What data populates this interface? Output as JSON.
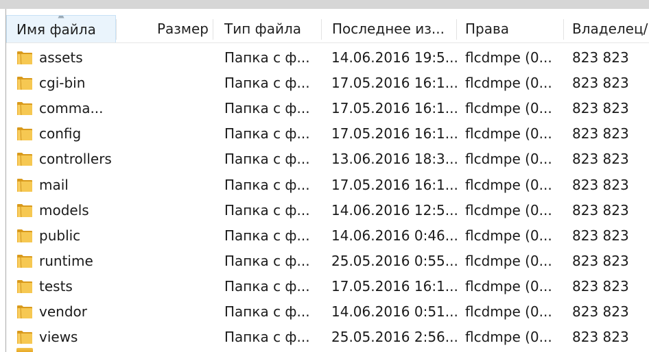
{
  "columns": [
    {
      "label": "Имя файла"
    },
    {
      "label": "Размер"
    },
    {
      "label": "Тип файла"
    },
    {
      "label": "Последнее из..."
    },
    {
      "label": "Права"
    },
    {
      "label": "Владелец/"
    }
  ],
  "sort_arrow": "▲",
  "rows": [
    {
      "name": "assets",
      "size": "",
      "type": "Папка с ф...",
      "modified": "14.06.2016 19:5...",
      "perms": "flcdmpe (0...",
      "owner": "823 823"
    },
    {
      "name": "cgi-bin",
      "size": "",
      "type": "Папка с ф...",
      "modified": "17.05.2016 16:1...",
      "perms": "flcdmpe (0...",
      "owner": "823 823"
    },
    {
      "name": "comma...",
      "size": "",
      "type": "Папка с ф...",
      "modified": "17.05.2016 16:1...",
      "perms": "flcdmpe (0...",
      "owner": "823 823"
    },
    {
      "name": "config",
      "size": "",
      "type": "Папка с ф...",
      "modified": "17.05.2016 16:1...",
      "perms": "flcdmpe (0...",
      "owner": "823 823"
    },
    {
      "name": "controllers",
      "size": "",
      "type": "Папка с ф...",
      "modified": "13.06.2016 18:3...",
      "perms": "flcdmpe (0...",
      "owner": "823 823"
    },
    {
      "name": "mail",
      "size": "",
      "type": "Папка с ф...",
      "modified": "17.05.2016 16:1...",
      "perms": "flcdmpe (0...",
      "owner": "823 823"
    },
    {
      "name": "models",
      "size": "",
      "type": "Папка с ф...",
      "modified": "14.06.2016 12:5...",
      "perms": "flcdmpe (0...",
      "owner": "823 823"
    },
    {
      "name": "public",
      "size": "",
      "type": "Папка с ф...",
      "modified": "14.06.2016 0:46...",
      "perms": "flcdmpe (0...",
      "owner": "823 823"
    },
    {
      "name": "runtime",
      "size": "",
      "type": "Папка с ф...",
      "modified": "25.05.2016 0:55...",
      "perms": "flcdmpe (0...",
      "owner": "823 823"
    },
    {
      "name": "tests",
      "size": "",
      "type": "Папка с ф...",
      "modified": "17.05.2016 16:1...",
      "perms": "flcdmpe (0...",
      "owner": "823 823"
    },
    {
      "name": "vendor",
      "size": "",
      "type": "Папка с ф...",
      "modified": "14.06.2016 0:51...",
      "perms": "flcdmpe (0...",
      "owner": "823 823"
    },
    {
      "name": "views",
      "size": "",
      "type": "Папка с ф...",
      "modified": "25.05.2016 2:56...",
      "perms": "flcdmpe (0...",
      "owner": "823 823"
    }
  ],
  "icon": "folder-icon",
  "colors": {
    "folder": "#f0b93a",
    "header_sorted_bg": "#eaf4fc",
    "header_sorted_border": "#c7e1f6"
  }
}
